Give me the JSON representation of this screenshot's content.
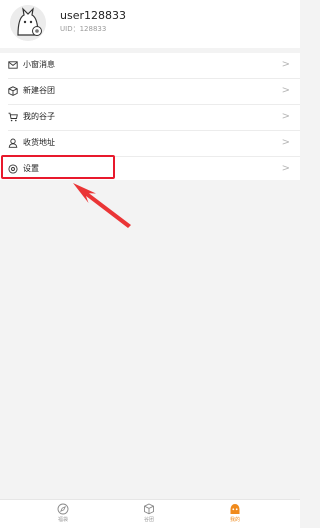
{
  "profile": {
    "username": "user128833",
    "uid_text": "UID：128833"
  },
  "menu": {
    "items": [
      {
        "label": "小窗消息",
        "icon": "mail-icon"
      },
      {
        "label": "新建谷团",
        "icon": "box-icon"
      },
      {
        "label": "我的谷子",
        "icon": "cart-icon"
      },
      {
        "label": "收货地址",
        "icon": "location-user-icon"
      },
      {
        "label": "设置",
        "icon": "settings-icon"
      }
    ],
    "chevron": ">"
  },
  "tabbar": {
    "tabs": [
      {
        "label": "福袋",
        "icon": "compass-icon",
        "active": false
      },
      {
        "label": "谷团",
        "icon": "cube-icon",
        "active": false
      },
      {
        "label": "我的",
        "icon": "profile-face-icon",
        "active": true
      }
    ],
    "active_color": "#f08a1c"
  },
  "annotation": {
    "highlight_color": "#e8192c"
  }
}
